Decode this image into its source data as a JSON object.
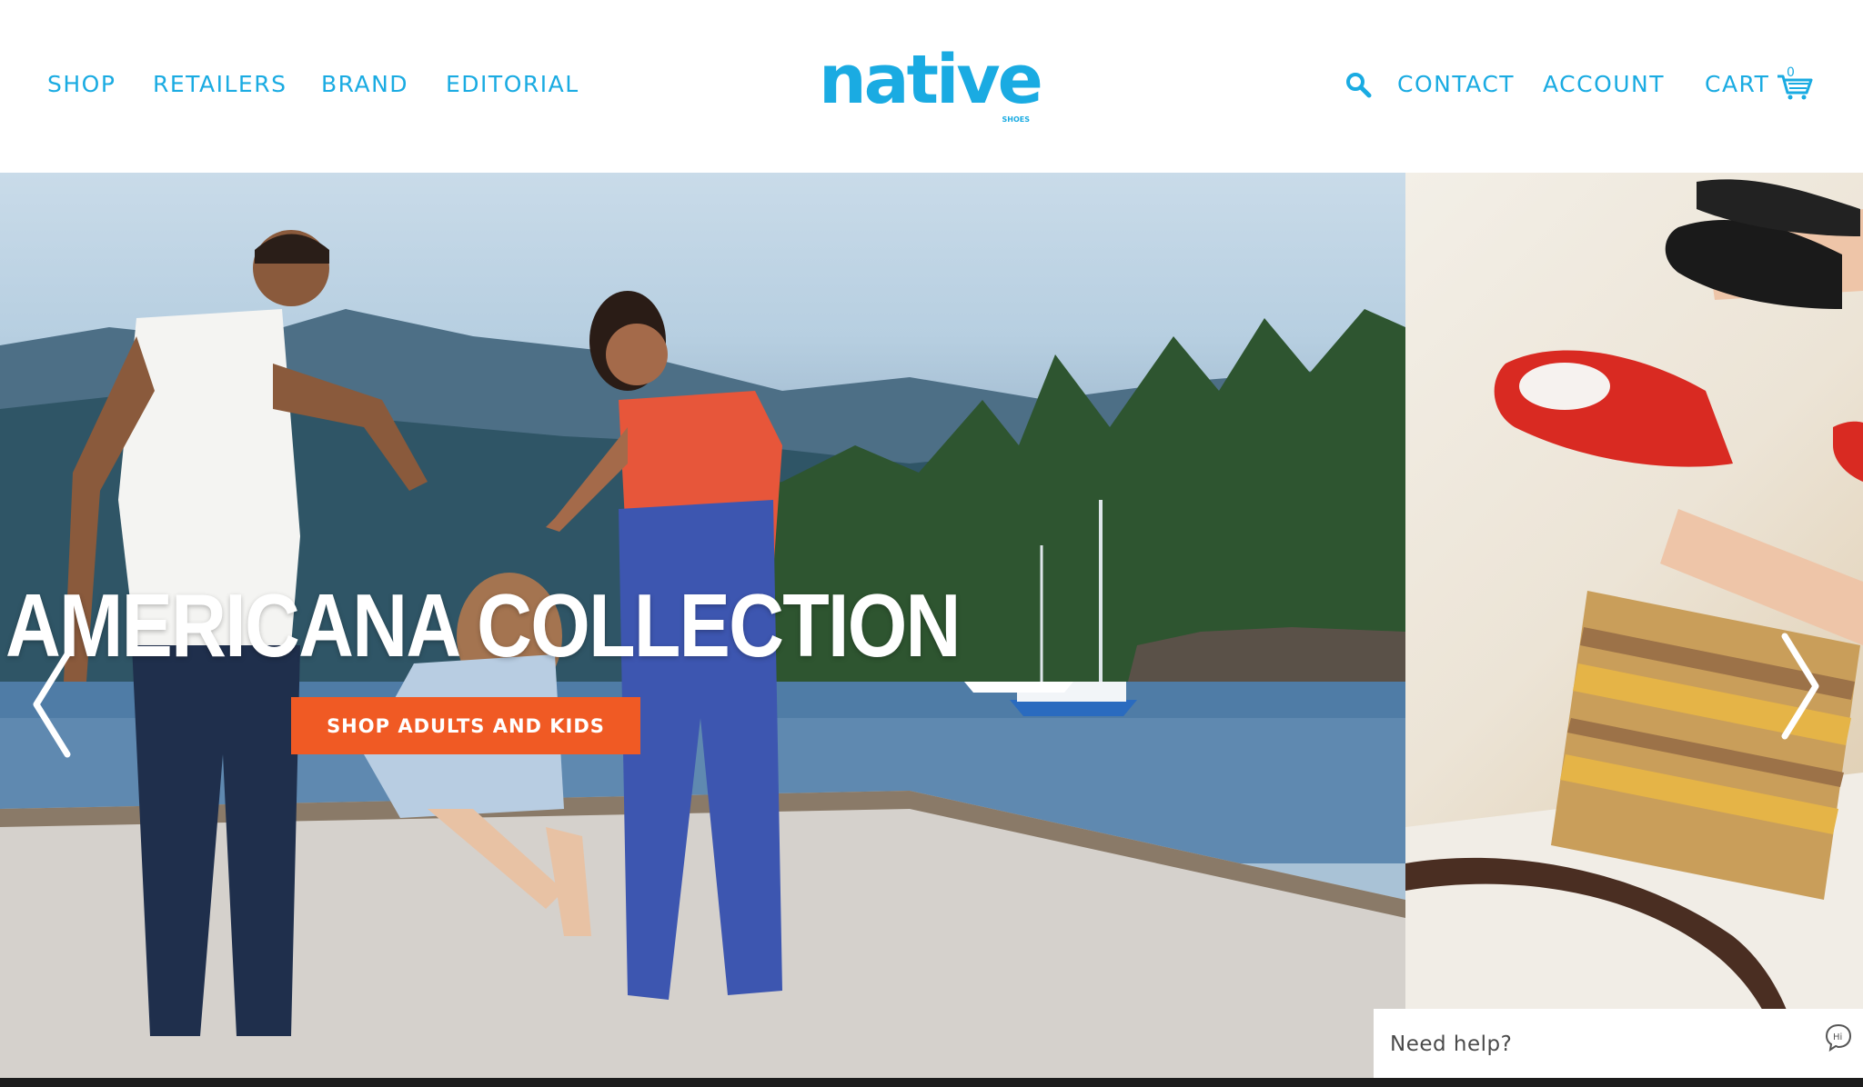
{
  "nav_left": [
    {
      "label": "SHOP"
    },
    {
      "label": "RETAILERS"
    },
    {
      "label": "BRAND"
    },
    {
      "label": "EDITORIAL"
    }
  ],
  "logo": {
    "text": "native",
    "reg_text": "SHOES"
  },
  "nav_right": {
    "search_icon": "search-icon",
    "contact": "CONTACT",
    "account": "ACCOUNT",
    "cart": "CART",
    "cart_count": "0"
  },
  "hero": {
    "title": "AMERICANA COLLECTION",
    "cta": "SHOP ADULTS AND KIDS",
    "prev_icon": "chevron-left-icon",
    "next_icon": "chevron-right-icon"
  },
  "help": {
    "label": "Need help?",
    "icon": "chat-bubble-icon"
  },
  "colors": {
    "brand": "#1aabe2",
    "cta": "#f05a24"
  }
}
